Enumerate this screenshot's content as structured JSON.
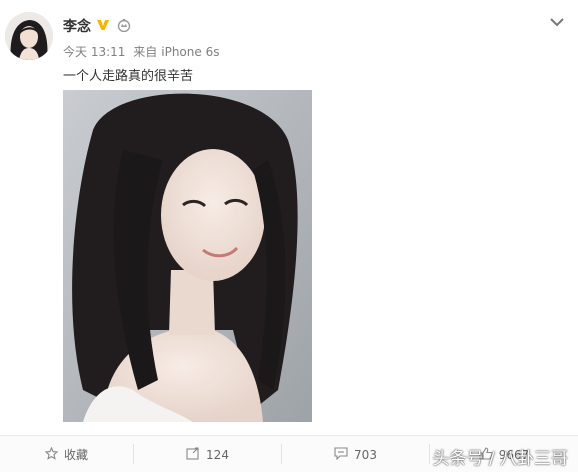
{
  "post": {
    "author": "李念",
    "time": "今天 13:11",
    "source_prefix": "来自",
    "source_device": "iPhone 6s",
    "text": "一个人走路真的很辛苦"
  },
  "actions": {
    "favorite_label": "收藏",
    "repost_count": "124",
    "comment_count": "703",
    "like_count": "9667"
  },
  "watermark": "头条号 / 八卦三哥",
  "colors": {
    "vip_badge": "#f7b500",
    "text_meta": "#808080",
    "action_text": "#666666"
  },
  "icons": [
    "chevron-down-icon",
    "verified-v-icon",
    "member-crown-icon",
    "star-icon",
    "repost-icon",
    "comment-icon",
    "like-icon"
  ]
}
